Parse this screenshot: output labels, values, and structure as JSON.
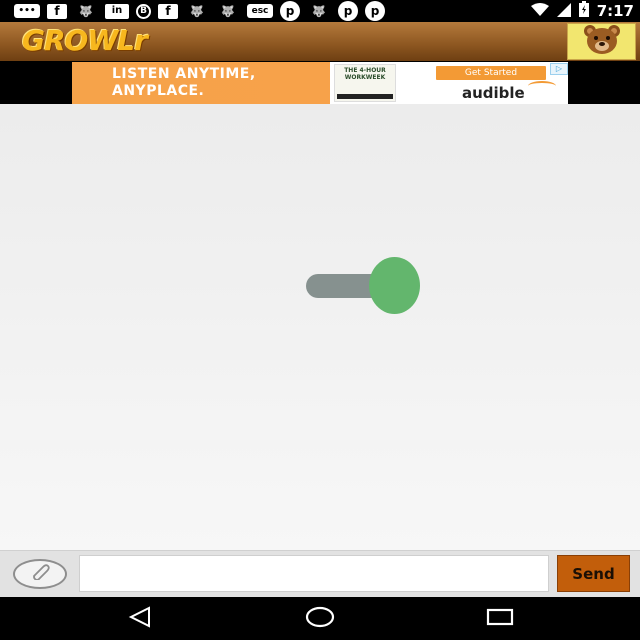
{
  "status_bar": {
    "time": "7:17",
    "notifications": [
      {
        "icon": "messaging-icon",
        "glyph": "•••",
        "style": "pill"
      },
      {
        "icon": "facebook-icon",
        "glyph": "f",
        "style": "box"
      },
      {
        "icon": "wolf-icon",
        "glyph": "🐺",
        "style": "plain"
      },
      {
        "icon": "linkedin-icon",
        "glyph": "in",
        "style": "linkedin"
      },
      {
        "icon": "blogger-icon",
        "glyph": "B",
        "style": "circle"
      },
      {
        "icon": "facebook-icon",
        "glyph": "f",
        "style": "box"
      },
      {
        "icon": "wolf-icon",
        "glyph": "🐺",
        "style": "plain"
      },
      {
        "icon": "wolf-icon",
        "glyph": "🐺",
        "style": "plain"
      },
      {
        "icon": "escape-key-icon",
        "glyph": "esc",
        "style": "pill"
      },
      {
        "icon": "pinterest-icon",
        "glyph": "p",
        "style": "pin"
      },
      {
        "icon": "wolf-icon",
        "glyph": "🐺",
        "style": "plain"
      },
      {
        "icon": "pinterest-icon",
        "glyph": "p",
        "style": "pin"
      },
      {
        "icon": "pinterest-icon",
        "glyph": "p",
        "style": "pin"
      }
    ]
  },
  "header": {
    "logo_text": "GROWLr",
    "avatar_icon": "bear-icon"
  },
  "ad": {
    "headline": "LISTEN ANYTIME, ANYPLACE.",
    "book_title": "THE 4-HOUR WORKWEEK",
    "cta": "Get Started",
    "brand": "audible",
    "choices_icon": "ad-choices-icon"
  },
  "toggle": {
    "state": "on",
    "thumb_color": "#63b66d",
    "track_color": "#86918f"
  },
  "composer": {
    "attach_icon": "paperclip-icon",
    "input_value": "",
    "input_placeholder": "",
    "send_label": "Send"
  },
  "nav": {
    "back_icon": "back-triangle-icon",
    "home_icon": "home-circle-icon",
    "recents_icon": "recents-square-icon"
  },
  "colors": {
    "header_brown": "#8c5620",
    "logo_gold": "#f7b71e",
    "send_orange": "#c25e0b",
    "ad_orange": "#f6a34a"
  }
}
